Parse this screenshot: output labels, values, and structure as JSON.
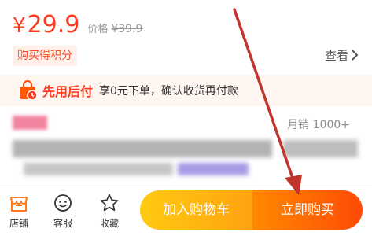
{
  "price": {
    "currency": "¥",
    "value": "29.9",
    "original_label": "价格",
    "original_value": "¥39.9"
  },
  "points_badge": "购买得积分",
  "view_link": "查看",
  "pay_later": {
    "title": "先用后付",
    "description": "享0元下单，确认收货再付款"
  },
  "monthly_sales": "月销 1000+",
  "bottom_nav": {
    "store": "店铺",
    "service": "客服",
    "favorite": "收藏"
  },
  "actions": {
    "add_to_cart": "加入购物车",
    "buy_now": "立即购买"
  },
  "colors": {
    "price_red": "#ff3b1f",
    "cart_button": "#ffb30f",
    "buy_button": "#ff5a06",
    "annotation_arrow": "#c0362c"
  }
}
